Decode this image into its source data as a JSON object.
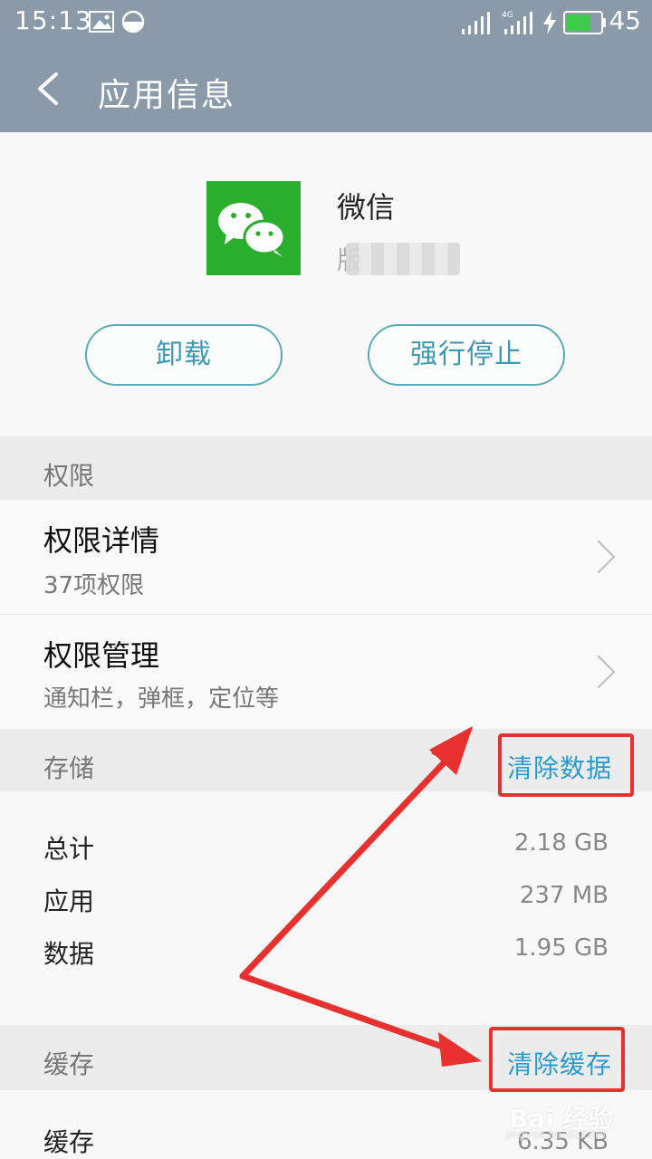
{
  "status_bar": {
    "time": "15:13",
    "battery_level": "45",
    "network": "4G",
    "icons": [
      "image-icon",
      "data-saver-icon",
      "signal-icon",
      "signal-4g-icon",
      "charging-icon",
      "battery-icon"
    ]
  },
  "app_bar": {
    "title": "应用信息",
    "back_icon": "back-arrow-icon"
  },
  "app": {
    "name": "微信",
    "version_prefix": "版",
    "icon": "wechat-app-icon",
    "icon_color": "#2aae2d"
  },
  "actions": {
    "uninstall": "卸载",
    "force_stop": "强行停止"
  },
  "permissions": {
    "section_title": "权限",
    "items": [
      {
        "title": "权限详情",
        "subtitle": "37项权限"
      },
      {
        "title": "权限管理",
        "subtitle": "通知栏，弹框，定位等"
      }
    ]
  },
  "storage": {
    "section_title": "存储",
    "clear_button": "清除数据",
    "rows": [
      {
        "label": "总计",
        "value": "2.18 GB"
      },
      {
        "label": "应用",
        "value": "237 MB"
      },
      {
        "label": "数据",
        "value": "1.95 GB"
      }
    ]
  },
  "cache": {
    "section_title": "缓存",
    "clear_button": "清除缓存",
    "rows": [
      {
        "label": "缓存",
        "value": "6.35 KB"
      }
    ]
  },
  "annotation": {
    "highlight_color": "#e8312f"
  },
  "watermark": {
    "text": "Bai 经验",
    "sub": "jingyan.baidu.com"
  }
}
